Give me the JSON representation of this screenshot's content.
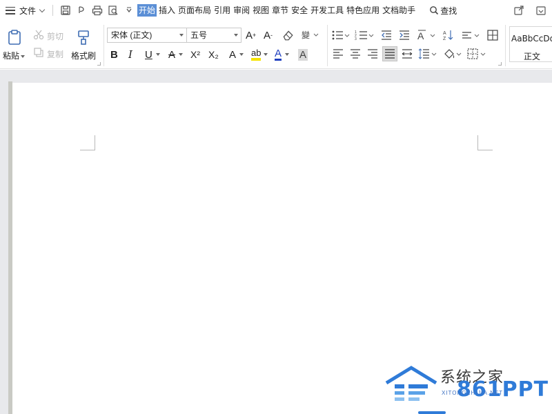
{
  "menubar": {
    "file_label": "文件",
    "tabs": [
      "开始",
      "插入",
      "页面布局",
      "引用",
      "审阅",
      "视图",
      "章节",
      "安全",
      "开发工具",
      "特色应用",
      "文档助手"
    ],
    "search_label": "查找"
  },
  "ribbon": {
    "paste_label": "粘贴",
    "cut_label": "剪切",
    "copy_label": "复制",
    "format_painter_label": "格式刷",
    "font_name": "宋体 (正文)",
    "font_size": "五号",
    "bold": "B",
    "italic": "I",
    "underline": "U",
    "strike": "A",
    "superscript": "X²",
    "subscript": "X₂",
    "text_effect": "A",
    "highlight": "ab",
    "font_color": "A",
    "char_shade": "A",
    "grow_font": "A",
    "shrink_font": "A",
    "style_preview": "AaBbCcDd",
    "style_name": "正文"
  },
  "watermark": {
    "zh": "系统之家",
    "en": "XITONGZHIJIA.NET",
    "ppt": "861PPT"
  },
  "colors": {
    "accent": "#5b8fd6",
    "highlight_yellow": "#f5e300",
    "font_red": "#d42020",
    "font_blue": "#1f3fbf",
    "watermark_blue": "#2f7bd8"
  }
}
